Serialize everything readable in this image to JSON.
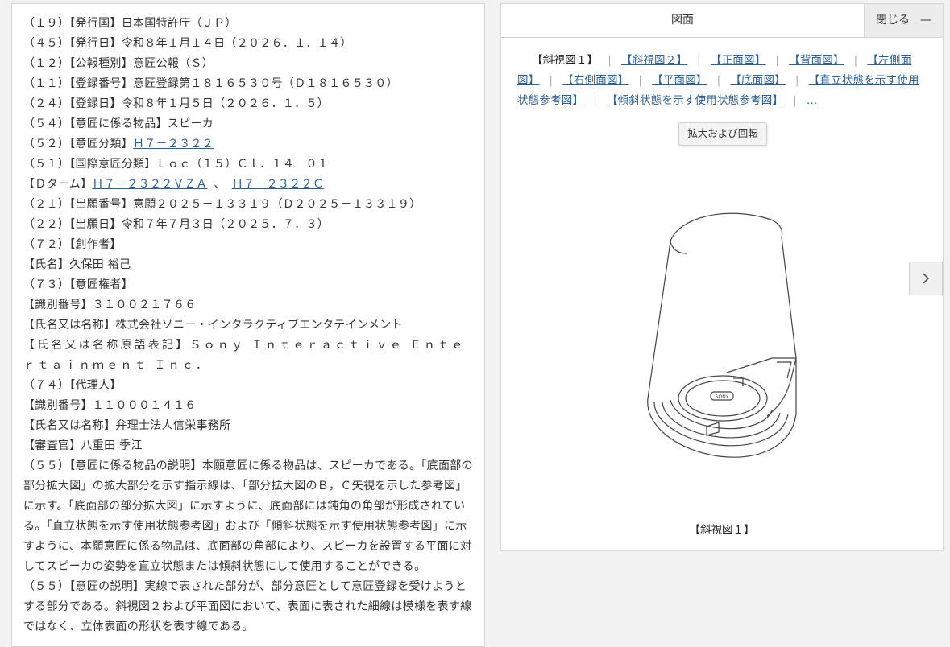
{
  "document": {
    "lines": [
      "（１９）【発行国】日本国特許庁（ＪＰ）",
      "（４５）【発行日】令和８年１月１４日（２０２６．１．１４）",
      "（１２）【公報種別】意匠公報（Ｓ）",
      "（１１）【登録番号】意匠登録第１８１６５３０号（Ｄ１８１６５３０）",
      "（２４）【登録日】令和８年１月５日（２０２６．１．５）",
      "（５４）【意匠に係る物品】スピーカ"
    ],
    "classification_label": "（５２）【意匠分類】",
    "classification_link": "Ｈ７－２３２２",
    "intl_classification": "（５１）【国際意匠分類】Ｌｏｃ（１５）Ｃｌ．１４－０１",
    "dterm_label": "【Ｄターム】",
    "dterm_link1": "Ｈ７－２３２２ＶＺＡ",
    "dterm_sep": "、",
    "dterm_link2": "Ｈ７－２３２２Ｃ",
    "lines2": [
      "（２１）【出願番号】意願２０２５－１３３１９（Ｄ２０２５－１３３１９）",
      "（２２）【出願日】令和７年７月３日（２０２５．７．３）",
      "（７２）【創作者】",
      "【氏名】久保田 裕己",
      "（７３）【意匠権者】",
      "【識別番号】３１００２１７６６",
      "【氏名又は名称】株式会社ソニー・インタラクティブエンタテインメント",
      "【氏名又は名称原語表記】Ｓｏｎｙ Ｉｎｔｅｒａｃｔｉｖｅ Ｅｎｔｅｒｔａｉｎｍｅｎｔ Ｉｎｃ．",
      "（７４）【代理人】",
      "【識別番号】１１０００１４１６",
      "【氏名又は名称】弁理士法人信栄事務所",
      "【審査官】八重田 季江"
    ],
    "para1": "（５５）【意匠に係る物品の説明】本願意匠に係る物品は、スピーカである。「底面部の部分拡大図」の拡大部分を示す指示線は、「部分拡大図のＢ，Ｃ矢視を示した参考図」に示す。「底面部の部分拡大図」に示すように、底面部には鈍角の角部が形成されている。「直立状態を示す使用状態参考図」および「傾斜状態を示す使用状態参考図」に示すように、本願意匠に係る物品は、底面部の角部により、スピーカを設置する平面に対してスピーカの姿勢を直立状態または傾斜状態にして使用することができる。",
    "para2": "（５５）【意匠の説明】実線で表された部分が、部分意匠として意匠登録を受けようとする部分である。斜視図２および平面図において、表面に表された細線は模様を表す線ではなく、立体表面の形状を表す線である。"
  },
  "figure_panel": {
    "title": "図面",
    "close_label": "閉じる",
    "close_dash": "—",
    "tabs": [
      {
        "label": "【斜視図１】",
        "active": true
      },
      {
        "label": "【斜視図２】",
        "active": false
      },
      {
        "label": "【正面図】",
        "active": false
      },
      {
        "label": "【背面図】",
        "active": false
      },
      {
        "label": "【左側面図】",
        "active": false
      },
      {
        "label": "【右側面図】",
        "active": false
      },
      {
        "label": "【平面図】",
        "active": false
      },
      {
        "label": "【底面図】",
        "active": false
      },
      {
        "label": "【直立状態を示す使用状態参考図】",
        "active": false
      },
      {
        "label": "【傾斜状態を示す使用状態参考図】",
        "active": false
      },
      {
        "label": "…",
        "active": false
      }
    ],
    "zoom_label": "拡大および回転",
    "caption": "【斜視図１】",
    "device_logo_text": "SONY"
  }
}
